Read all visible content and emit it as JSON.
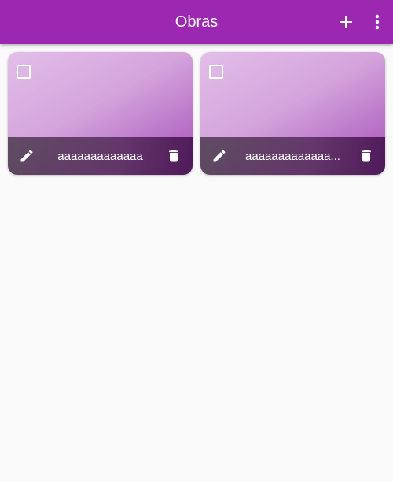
{
  "appbar": {
    "title": "Obras",
    "add_icon": "plus-icon",
    "more_icon": "more-vert-icon",
    "color": "#9c27b0"
  },
  "cards": [
    {
      "name": "aaaaaaaaaaaaa",
      "checked": false,
      "edit_icon": "pencil-icon",
      "delete_icon": "trash-icon"
    },
    {
      "name": "aaaaaaaaaaaaa...",
      "checked": false,
      "edit_icon": "pencil-icon",
      "delete_icon": "trash-icon"
    }
  ]
}
